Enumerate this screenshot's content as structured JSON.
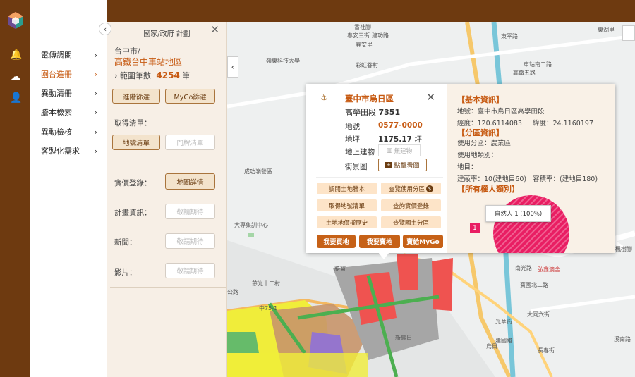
{
  "rail": {
    "icons": [
      "bell-icon",
      "cloud-upload-icon",
      "user-icon"
    ]
  },
  "menu": {
    "items": [
      {
        "label": "電傳調閱",
        "active": false
      },
      {
        "label": "園台造冊",
        "active": true
      },
      {
        "label": "異動清冊",
        "active": false
      },
      {
        "label": "謄本檢索",
        "active": false
      },
      {
        "label": "異動檢核",
        "active": false
      },
      {
        "label": "客製化需求",
        "active": false
      }
    ]
  },
  "panel": {
    "title": "國家/政府 計劃",
    "city": "台中市/",
    "area": "高鐵台中車站地區",
    "count_label": "範圍筆數",
    "count_value": "4254",
    "count_unit": "筆",
    "btn_filter": "進階篩選",
    "btn_mygo": "MyGo篩選",
    "list_label": "取得清單：",
    "btn_parcel_list": "地號清單",
    "btn_door_list": "門牌清單",
    "price_label": "實價登錄：",
    "btn_map_detail": "地圖詳情",
    "plan_label": "計畫資訊：",
    "news_label": "新聞：",
    "video_label": "影片：",
    "coming": "敬請期待"
  },
  "popup": {
    "district": "臺中市烏日區",
    "section": "高學田段",
    "section_no": "7351",
    "lot_label": "地號",
    "lot_value": "0577-0000",
    "area_label": "地坪",
    "area_value": "1175.17",
    "area_unit": "坪",
    "building_label": "地上建物",
    "building_value": "無建物",
    "street_label": "街景圖",
    "street_btn": "點擊看圖",
    "actions": [
      "調閱土地謄本",
      "查覽使用分區",
      "取得地號清單",
      "查詢實價登錄",
      "土地地價權歷史",
      "查覽國土分區"
    ],
    "buy": "我要買地",
    "sell": "我要賣地",
    "mygo": "賣給MyGo"
  },
  "info": {
    "basic_header": "【基本資訊】",
    "address": "地號：臺中市烏日區高學田段",
    "lng": "經度：120.6114083",
    "lat": "緯度：24.1160197",
    "zone_header": "【分區資訊】",
    "zone": "使用分區：農業區",
    "land_cat": "使用地類別：",
    "land_item": "地目：",
    "coverage": "建蔽率：10(建地目60)",
    "far": "容積率：(建地目180)",
    "owner_header": "【所有權人類別】",
    "tooltip": "自然人 1 (100%)",
    "legend_num": "1"
  },
  "map": {
    "labels": [
      "番社腳",
      "春安三街",
      "建功路",
      "春安里",
      "彩虹眷村",
      "嶺東科技大學",
      "東平路",
      "成功嶺營區",
      "大專集訓中心",
      "勝寶",
      "慈光十二村",
      "南光路",
      "寶國北二路",
      "弘鑫澳舍",
      "新鳥日",
      "烏日",
      "建國路",
      "長春街",
      "光華街",
      "大同六街",
      "公路",
      "楓樹腳",
      "中75-1",
      "高鐵五路",
      "東湖里",
      "溪南路",
      "車站南二路"
    ],
    "shields": [
      "74",
      "74",
      "127",
      "74",
      "74"
    ]
  },
  "colors": {
    "brand": "#6e3a10",
    "accent": "#c75a12",
    "pie": "#e91e63"
  }
}
